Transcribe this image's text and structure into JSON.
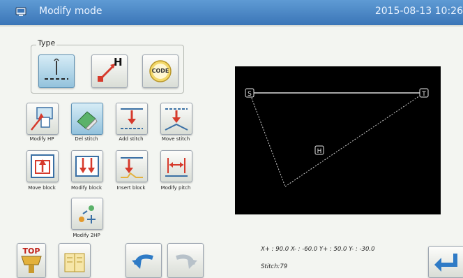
{
  "header": {
    "title": "Modify mode",
    "datetime": "2015-08-13 10:26"
  },
  "type_group": {
    "label": "Type",
    "code_label": "CODE",
    "h_label": "H"
  },
  "modify_buttons": [
    {
      "label": "Modify HP"
    },
    {
      "label": "Del stitch"
    },
    {
      "label": "Add stitch"
    },
    {
      "label": "Move stitch"
    },
    {
      "label": "Move block"
    },
    {
      "label": "Modify block"
    },
    {
      "label": "Insert block"
    },
    {
      "label": "Modify pitch"
    },
    {
      "label": "Modify 2HP"
    }
  ],
  "bottom": {
    "top_label": "TOP"
  },
  "preview": {
    "start_marker": "S",
    "end_marker": "T",
    "home_marker": "H"
  },
  "status": {
    "coords": "X+ : 90.0  X- : -60.0  Y+ : 50.0  Y- : -30.0",
    "stitch": "Stitch:79"
  }
}
